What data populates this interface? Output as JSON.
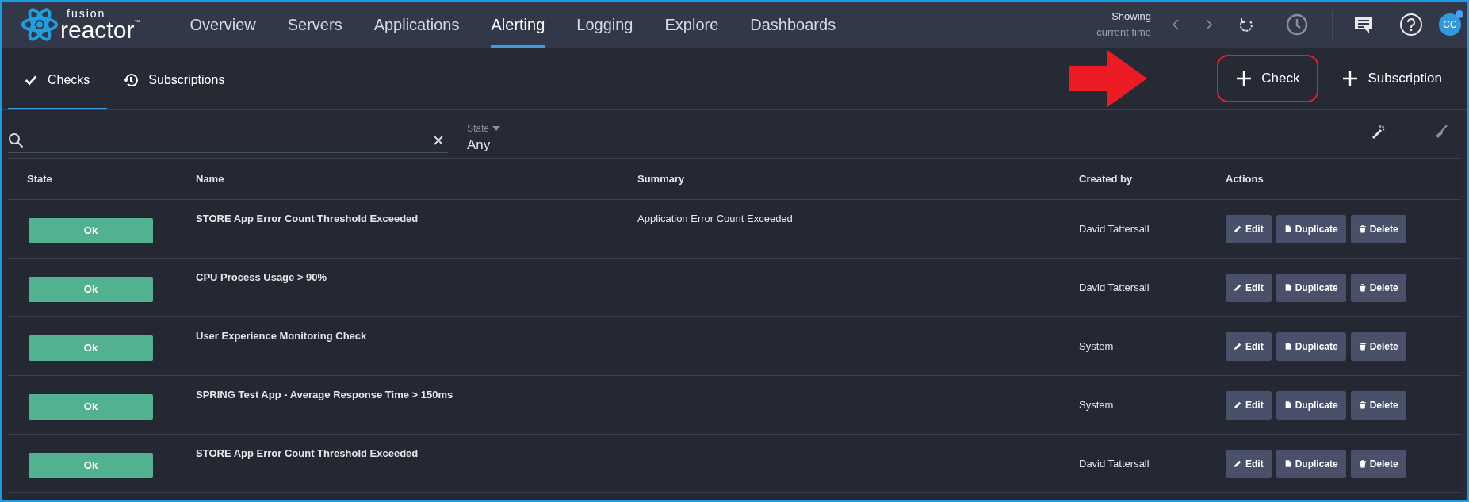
{
  "logo": {
    "top": "fusion",
    "main": "reactor",
    "mark": "™"
  },
  "nav": [
    {
      "label": "Overview",
      "selected": false
    },
    {
      "label": "Servers",
      "selected": false
    },
    {
      "label": "Applications",
      "selected": false
    },
    {
      "label": "Alerting",
      "selected": true
    },
    {
      "label": "Logging",
      "selected": false
    },
    {
      "label": "Explore",
      "selected": false
    },
    {
      "label": "Dashboards",
      "selected": false
    }
  ],
  "time": {
    "line1": "Showing",
    "line2": "current time"
  },
  "user": {
    "initials": "CC",
    "notification": true
  },
  "subtabs": [
    {
      "label": "Checks",
      "selected": true
    },
    {
      "label": "Subscriptions",
      "selected": false
    }
  ],
  "add_buttons": [
    {
      "label": "Check",
      "highlighted": true
    },
    {
      "label": "Subscription",
      "highlighted": false
    }
  ],
  "filter": {
    "state_label": "State",
    "state_value": "Any"
  },
  "table": {
    "columns": [
      "State",
      "Name",
      "Summary",
      "Created by",
      "Actions"
    ],
    "rows": [
      {
        "state": "Ok",
        "name": "STORE App Error Count Threshold Exceeded",
        "summary": "Application Error Count Exceeded",
        "created_by": "David Tattersall",
        "actions": [
          "Edit",
          "Duplicate",
          "Delete"
        ]
      },
      {
        "state": "Ok",
        "name": "CPU Process Usage > 90%",
        "created_by": "David Tattersall",
        "actions": [
          "Edit",
          "Duplicate",
          "Delete"
        ]
      },
      {
        "state": "Ok",
        "name": "User Experience Monitoring Check",
        "created_by": "System",
        "actions": [
          "Edit",
          "Duplicate",
          "Delete"
        ]
      },
      {
        "state": "Ok",
        "name": "SPRING Test App - Average Response Time > 150ms",
        "created_by": "System",
        "actions": [
          "Edit",
          "Duplicate",
          "Delete"
        ]
      },
      {
        "state": "Ok",
        "name": "STORE App Error Count Threshold Exceeded",
        "created_by": "David Tattersall",
        "actions": [
          "Edit",
          "Duplicate",
          "Delete"
        ]
      }
    ]
  }
}
